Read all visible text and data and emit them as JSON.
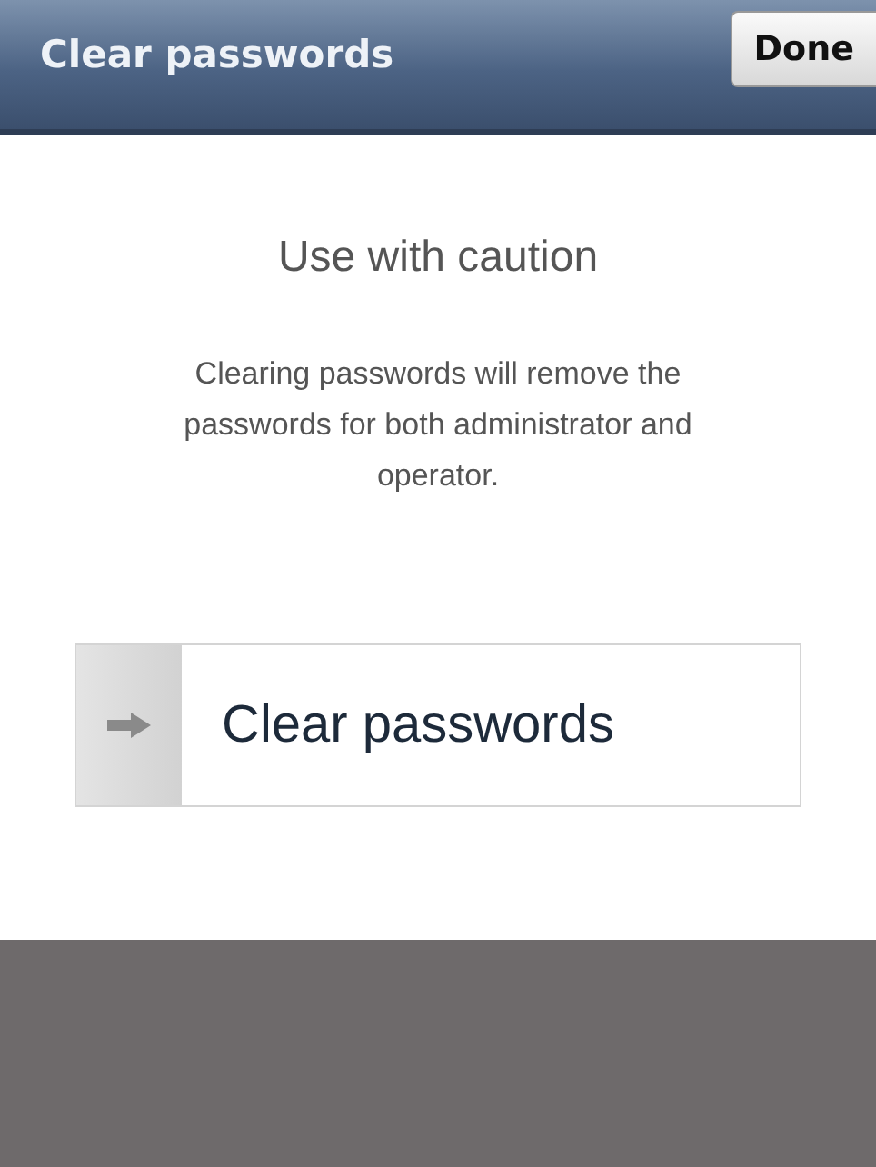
{
  "header": {
    "title": "Clear passwords",
    "done_button": "Done"
  },
  "heading": "Use with caution",
  "message": "Clearing passwords will remove the passwords for both administrator and operator.",
  "action_button": {
    "label": "Clear passwords"
  }
}
